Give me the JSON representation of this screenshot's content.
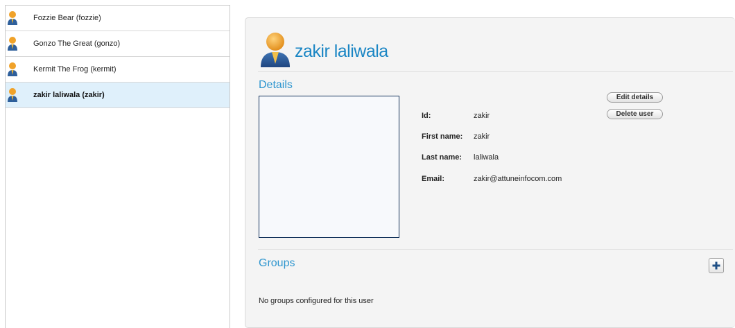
{
  "users": [
    {
      "label": "Fozzie Bear (fozzie)",
      "selected": false
    },
    {
      "label": "Gonzo The Great (gonzo)",
      "selected": false
    },
    {
      "label": "Kermit The Frog (kermit)",
      "selected": false
    },
    {
      "label": "zakir laliwala (zakir)",
      "selected": true
    }
  ],
  "detail": {
    "name": "zakir laliwala",
    "details_title": "Details",
    "edit_label": "Edit details",
    "delete_label": "Delete user",
    "fields": {
      "id_label": "Id:",
      "id_value": "zakir",
      "first_label": "First name:",
      "first_value": "zakir",
      "last_label": "Last name:",
      "last_value": "laliwala",
      "email_label": "Email:",
      "email_value": "zakir@attuneinfocom.com"
    },
    "groups_title": "Groups",
    "groups_empty": "No groups configured for this user"
  },
  "icons": {
    "user_avatar": "user-avatar-icon",
    "add": "plus-icon"
  },
  "colors": {
    "accent_blue": "#1b86c4",
    "selected_row": "#dff0fb",
    "avatar_orange": "#f0a229",
    "avatar_body_blue": "#2e5f9b"
  }
}
